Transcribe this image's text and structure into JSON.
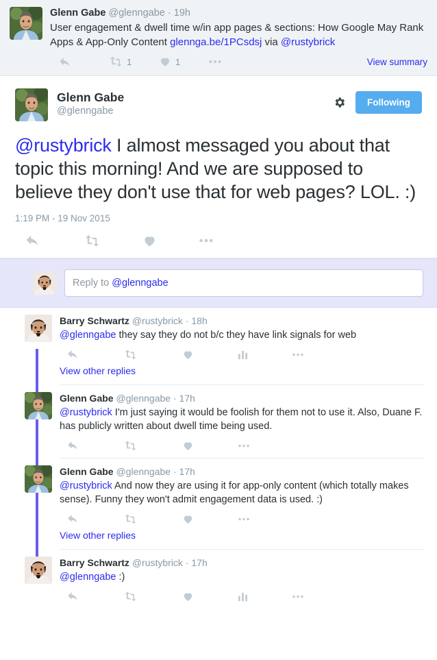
{
  "ancestor_tweet": {
    "author_name": "Glenn Gabe",
    "author_handle": "@glenngabe",
    "separator": "·",
    "timestamp": "19h",
    "text_part1": "User engagement & dwell time w/in app pages & sections: How Google May Rank Apps & App-Only Content ",
    "link_text": "glennga.be/1PCsdsj",
    "text_part2": " via ",
    "mention": "@rustybrick",
    "retweet_count": "1",
    "like_count": "1",
    "view_summary_label": "View summary"
  },
  "main_tweet": {
    "author_name": "Glenn Gabe",
    "author_handle": "@glenngabe",
    "mention": "@rustybrick",
    "text": " I almost messaged you about that topic this morning! And we are supposed to believe they don't use that for web pages? LOL. :)",
    "timestamp": "1:19 PM - 19 Nov 2015",
    "following_label": "Following"
  },
  "composer": {
    "placeholder_prefix": "Reply to ",
    "placeholder_mention": "@glenngabe"
  },
  "replies": [
    {
      "author_name": "Barry Schwartz",
      "author_handle": "@rustybrick",
      "separator": "·",
      "timestamp": "18h",
      "mention": "@glenngabe",
      "text": " they say they do not b/c they have link signals for web",
      "has_stats_icon": true,
      "view_other_label": "View other replies",
      "avatar": "barry"
    },
    {
      "author_name": "Glenn Gabe",
      "author_handle": "@glenngabe",
      "separator": "·",
      "timestamp": "17h",
      "mention": "@rustybrick",
      "text": " I'm just saying it would be foolish for them not to use it. Also, Duane F. has publicly written about dwell time being used.",
      "has_stats_icon": false,
      "view_other_label": "",
      "avatar": "glenn"
    },
    {
      "author_name": "Glenn Gabe",
      "author_handle": "@glenngabe",
      "separator": "·",
      "timestamp": "17h",
      "mention": "@rustybrick",
      "text": " And now they are using it for app-only content (which totally makes sense). Funny they won't admit engagement data is used. :)",
      "has_stats_icon": false,
      "view_other_label": "View other replies",
      "avatar": "glenn"
    },
    {
      "author_name": "Barry Schwartz",
      "author_handle": "@rustybrick",
      "separator": "·",
      "timestamp": "17h",
      "mention": "@glenngabe",
      "text": " :)",
      "has_stats_icon": true,
      "view_other_label": "",
      "avatar": "barry"
    }
  ],
  "icons": {
    "reply": "reply-icon",
    "retweet": "retweet-icon",
    "like": "heart-icon",
    "more": "ellipsis-icon",
    "stats": "analytics-icon",
    "gear": "gear-icon"
  },
  "colors": {
    "accent_blue": "#55acee",
    "link_blue": "#2b2bf0",
    "icon_gray": "#c2ccd4",
    "meta_gray": "#8899a6",
    "text_dark": "#292f33",
    "ancestor_bg": "#f0f3f5",
    "composer_bg": "#e6e6fb",
    "connector": "#6a5bf0"
  }
}
